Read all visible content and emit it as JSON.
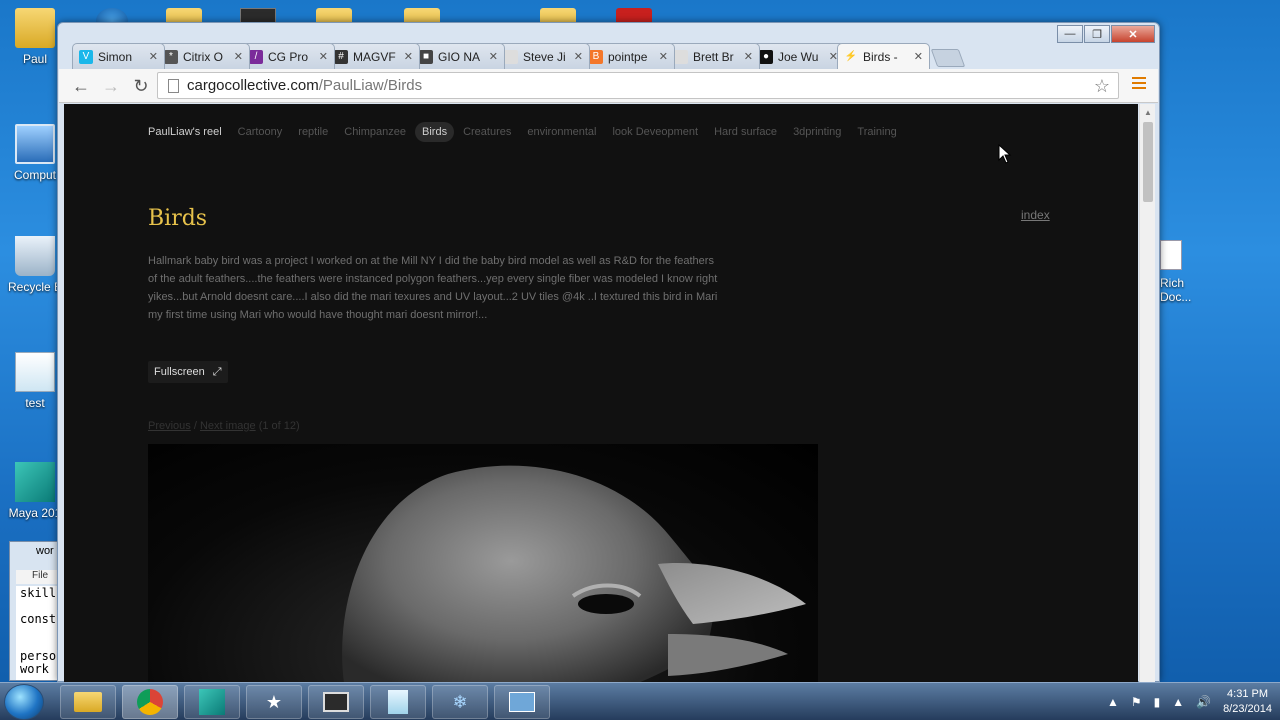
{
  "desktop": {
    "icons": [
      {
        "label": "Paul"
      },
      {
        "label": "Comput"
      },
      {
        "label": "Recycle B"
      },
      {
        "label": "test"
      },
      {
        "label": "Maya 201"
      }
    ],
    "right_icon_label": "Rich\nDoc..."
  },
  "browser": {
    "tabs": [
      {
        "label": "Simon",
        "favicon_color": "#1ab7ea",
        "favicon": "V"
      },
      {
        "label": "Citrix O",
        "favicon_color": "#555555",
        "favicon": "*"
      },
      {
        "label": "CG Pro",
        "favicon_color": "#7b2b9a",
        "favicon": "/"
      },
      {
        "label": "MAGVF",
        "favicon_color": "#333333",
        "favicon": "#"
      },
      {
        "label": "GIO NA",
        "favicon_color": "#444444",
        "favicon": "■"
      },
      {
        "label": "Steve Ji",
        "favicon_color": "#dddddd",
        "favicon": ""
      },
      {
        "label": "pointpe",
        "favicon_color": "#f4772a",
        "favicon": "B"
      },
      {
        "label": "Brett Br",
        "favicon_color": "#dddddd",
        "favicon": ""
      },
      {
        "label": "Joe Wu",
        "favicon_color": "#111111",
        "favicon": "●"
      },
      {
        "label": "Birds -",
        "favicon_color": "#f6f6f6",
        "favicon": "⚡",
        "active": true
      }
    ],
    "url_host": "cargocollective.com",
    "url_path": "/PaulLiaw/Birds"
  },
  "site": {
    "nav": [
      "PaulLiaw's reel",
      "Cartoony",
      "reptile",
      "Chimpanzee",
      "Birds",
      "Creatures",
      "environmental",
      "look Deveopment",
      "Hard surface",
      "3dprinting",
      "Training"
    ],
    "current_nav": "Birds",
    "title": "Birds",
    "index_link": "index",
    "description": "Hallmark baby bird was a project I worked on at the Mill NY I did the baby bird model as well as R&D for the feathers of the adult feathers....the feathers were instanced polygon feathers...yep every single fiber was modeled I know right yikes...but Arnold doesnt care....I also did the mari texures and UV layout...2 UV tiles @4k ..I textured this bird in Mari my first time using Mari who would have thought mari doesnt mirror!...",
    "fullscreen_label": "Fullscreen",
    "pager": {
      "previous": "Previous",
      "separator": "/",
      "next": "Next image",
      "count": "(1 of 12)"
    },
    "title_color": "#e7c24b"
  },
  "mini_window": {
    "title": "wor",
    "menu": "File",
    "lines": [
      "skill",
      "const",
      "perso\nwork"
    ]
  },
  "taskbar": {
    "time": "4:31 PM",
    "date": "8/23/2014"
  }
}
